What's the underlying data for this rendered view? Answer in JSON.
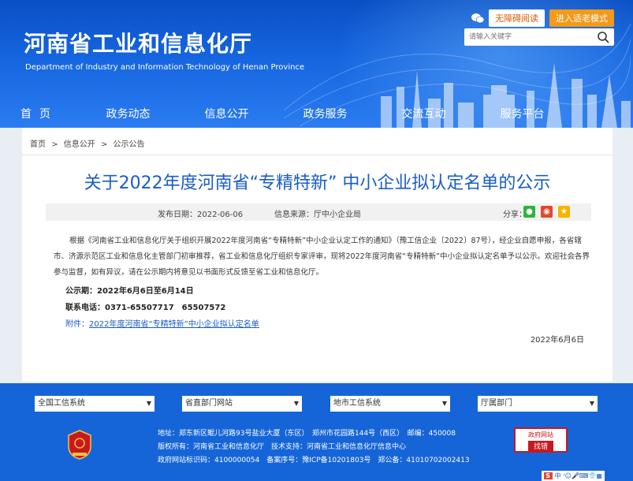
{
  "header": {
    "title": "河南省工业和信息化厅",
    "subtitle": "Department of Industry and Information Technology of Henan Province",
    "accessible_btn": "无障碍阅读",
    "elder_btn": "进入适老模式",
    "search_placeholder": "请输入关键字"
  },
  "nav": [
    "首页",
    "政务动态",
    "信息公开",
    "政务服务",
    "交流互动",
    "服务平台"
  ],
  "breadcrumb": [
    "首页",
    ">",
    "信息公开",
    ">",
    "公示公告"
  ],
  "article": {
    "title": "关于2022年度河南省“专精特新” 中小企业拟认定名单的公示",
    "date": "发布日期：2022-06-06",
    "source": "信息来源：厅中小企业局",
    "share_label": "分享：",
    "body": "根据《河南省工业和信息化厅关于组织开展2022年度河南省“专精特新”中小企业认定工作的通知》（豫工信企业〔2022〕87号），经企业自愿申报，各省辖市、济源示范区工业和信息化主管部门初审推荐，省工业和信息化厅组织专家评审，现将2022年度河南省“专精特新”中小企业拟认定名单予以公示。欢迎社会各界参与监督，如有异议，请在公示期内将意见以书面形式反馈至省工业和信息化厅。",
    "period": "公示期：2022年6月6日至6月14日",
    "phone": "联系电话：0371-65507717　65507572",
    "attach_label": "附件：",
    "attach_link": "2022年度河南省“专精特新”中小企业拟认定名单",
    "sign_date": "2022年6月6日"
  },
  "footer": {
    "selects": [
      "全国工信系统",
      "省直部门网站",
      "地市工信系统",
      "厅属部门"
    ],
    "line1": "地址：郑东新区鲲儿河路93号盐业大厦（东区）　郑州市花园路144号（西区）　邮编：450008",
    "line2": "版权所有：河南省工业和信息化厅　技术支持：河南省工业和信息化厅信息中心",
    "line3": "政府网站标识码：4100000054　备案序号：豫ICP备10201803号　郑公备：41010702002413",
    "badge_top": "政府网站",
    "badge_bottom": "找错",
    "toolbar": "中"
  },
  "colors": {
    "header_blue": "#1565e0",
    "title_blue": "#1a5cc8",
    "elder_orange": "#f39a1a",
    "footer_blue": "#1565d8"
  }
}
